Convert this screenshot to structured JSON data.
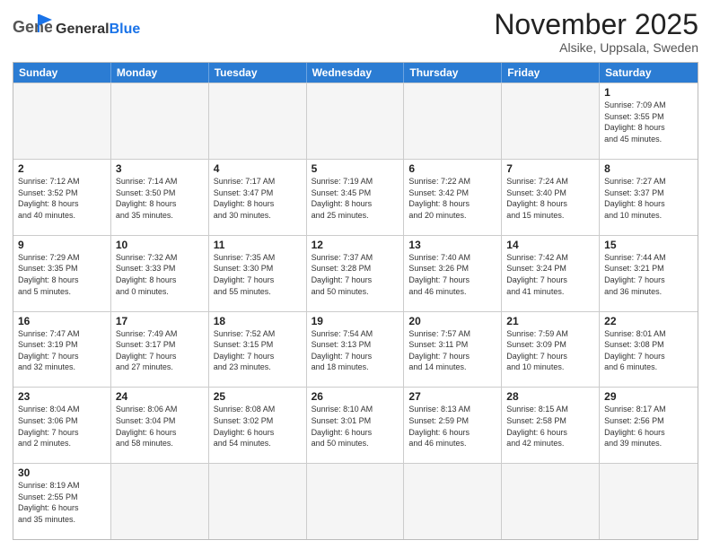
{
  "header": {
    "logo_general": "General",
    "logo_blue": "Blue",
    "title": "November 2025",
    "subtitle": "Alsike, Uppsala, Sweden"
  },
  "dow": [
    "Sunday",
    "Monday",
    "Tuesday",
    "Wednesday",
    "Thursday",
    "Friday",
    "Saturday"
  ],
  "weeks": [
    [
      {
        "day": "",
        "info": ""
      },
      {
        "day": "",
        "info": ""
      },
      {
        "day": "",
        "info": ""
      },
      {
        "day": "",
        "info": ""
      },
      {
        "day": "",
        "info": ""
      },
      {
        "day": "",
        "info": ""
      },
      {
        "day": "1",
        "info": "Sunrise: 7:09 AM\nSunset: 3:55 PM\nDaylight: 8 hours\nand 45 minutes."
      }
    ],
    [
      {
        "day": "2",
        "info": "Sunrise: 7:12 AM\nSunset: 3:52 PM\nDaylight: 8 hours\nand 40 minutes."
      },
      {
        "day": "3",
        "info": "Sunrise: 7:14 AM\nSunset: 3:50 PM\nDaylight: 8 hours\nand 35 minutes."
      },
      {
        "day": "4",
        "info": "Sunrise: 7:17 AM\nSunset: 3:47 PM\nDaylight: 8 hours\nand 30 minutes."
      },
      {
        "day": "5",
        "info": "Sunrise: 7:19 AM\nSunset: 3:45 PM\nDaylight: 8 hours\nand 25 minutes."
      },
      {
        "day": "6",
        "info": "Sunrise: 7:22 AM\nSunset: 3:42 PM\nDaylight: 8 hours\nand 20 minutes."
      },
      {
        "day": "7",
        "info": "Sunrise: 7:24 AM\nSunset: 3:40 PM\nDaylight: 8 hours\nand 15 minutes."
      },
      {
        "day": "8",
        "info": "Sunrise: 7:27 AM\nSunset: 3:37 PM\nDaylight: 8 hours\nand 10 minutes."
      }
    ],
    [
      {
        "day": "9",
        "info": "Sunrise: 7:29 AM\nSunset: 3:35 PM\nDaylight: 8 hours\nand 5 minutes."
      },
      {
        "day": "10",
        "info": "Sunrise: 7:32 AM\nSunset: 3:33 PM\nDaylight: 8 hours\nand 0 minutes."
      },
      {
        "day": "11",
        "info": "Sunrise: 7:35 AM\nSunset: 3:30 PM\nDaylight: 7 hours\nand 55 minutes."
      },
      {
        "day": "12",
        "info": "Sunrise: 7:37 AM\nSunset: 3:28 PM\nDaylight: 7 hours\nand 50 minutes."
      },
      {
        "day": "13",
        "info": "Sunrise: 7:40 AM\nSunset: 3:26 PM\nDaylight: 7 hours\nand 46 minutes."
      },
      {
        "day": "14",
        "info": "Sunrise: 7:42 AM\nSunset: 3:24 PM\nDaylight: 7 hours\nand 41 minutes."
      },
      {
        "day": "15",
        "info": "Sunrise: 7:44 AM\nSunset: 3:21 PM\nDaylight: 7 hours\nand 36 minutes."
      }
    ],
    [
      {
        "day": "16",
        "info": "Sunrise: 7:47 AM\nSunset: 3:19 PM\nDaylight: 7 hours\nand 32 minutes."
      },
      {
        "day": "17",
        "info": "Sunrise: 7:49 AM\nSunset: 3:17 PM\nDaylight: 7 hours\nand 27 minutes."
      },
      {
        "day": "18",
        "info": "Sunrise: 7:52 AM\nSunset: 3:15 PM\nDaylight: 7 hours\nand 23 minutes."
      },
      {
        "day": "19",
        "info": "Sunrise: 7:54 AM\nSunset: 3:13 PM\nDaylight: 7 hours\nand 18 minutes."
      },
      {
        "day": "20",
        "info": "Sunrise: 7:57 AM\nSunset: 3:11 PM\nDaylight: 7 hours\nand 14 minutes."
      },
      {
        "day": "21",
        "info": "Sunrise: 7:59 AM\nSunset: 3:09 PM\nDaylight: 7 hours\nand 10 minutes."
      },
      {
        "day": "22",
        "info": "Sunrise: 8:01 AM\nSunset: 3:08 PM\nDaylight: 7 hours\nand 6 minutes."
      }
    ],
    [
      {
        "day": "23",
        "info": "Sunrise: 8:04 AM\nSunset: 3:06 PM\nDaylight: 7 hours\nand 2 minutes."
      },
      {
        "day": "24",
        "info": "Sunrise: 8:06 AM\nSunset: 3:04 PM\nDaylight: 6 hours\nand 58 minutes."
      },
      {
        "day": "25",
        "info": "Sunrise: 8:08 AM\nSunset: 3:02 PM\nDaylight: 6 hours\nand 54 minutes."
      },
      {
        "day": "26",
        "info": "Sunrise: 8:10 AM\nSunset: 3:01 PM\nDaylight: 6 hours\nand 50 minutes."
      },
      {
        "day": "27",
        "info": "Sunrise: 8:13 AM\nSunset: 2:59 PM\nDaylight: 6 hours\nand 46 minutes."
      },
      {
        "day": "28",
        "info": "Sunrise: 8:15 AM\nSunset: 2:58 PM\nDaylight: 6 hours\nand 42 minutes."
      },
      {
        "day": "29",
        "info": "Sunrise: 8:17 AM\nSunset: 2:56 PM\nDaylight: 6 hours\nand 39 minutes."
      }
    ],
    [
      {
        "day": "30",
        "info": "Sunrise: 8:19 AM\nSunset: 2:55 PM\nDaylight: 6 hours\nand 35 minutes."
      },
      {
        "day": "",
        "info": ""
      },
      {
        "day": "",
        "info": ""
      },
      {
        "day": "",
        "info": ""
      },
      {
        "day": "",
        "info": ""
      },
      {
        "day": "",
        "info": ""
      },
      {
        "day": "",
        "info": ""
      }
    ]
  ]
}
